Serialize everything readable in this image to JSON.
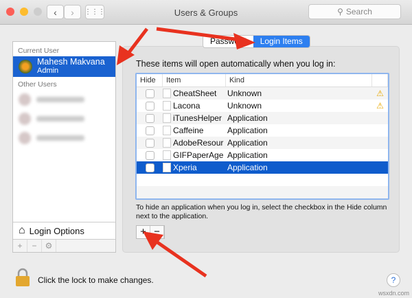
{
  "window": {
    "title": "Users & Groups",
    "search_placeholder": "Search"
  },
  "sidebar": {
    "current_user_header": "Current User",
    "current_user": {
      "name": "Mahesh Makvana",
      "role": "Admin"
    },
    "other_users_header": "Other Users",
    "login_options": "Login Options",
    "add": "+",
    "remove": "−",
    "gear": "⚙"
  },
  "tabs": [
    {
      "label": "Password"
    },
    {
      "label": "Login Items"
    }
  ],
  "login_items": {
    "intro": "These items will open automatically when you log in:",
    "columns": [
      "Hide",
      "Item",
      "Kind"
    ],
    "rows": [
      {
        "item": "CheatSheet",
        "kind": "Unknown",
        "warn": "⚠"
      },
      {
        "item": "Lacona",
        "kind": "Unknown",
        "warn": "⚠"
      },
      {
        "item": "iTunesHelper",
        "kind": "Application",
        "warn": ""
      },
      {
        "item": "Caffeine",
        "kind": "Application",
        "warn": ""
      },
      {
        "item": "AdobeResour",
        "kind": "Application",
        "warn": ""
      },
      {
        "item": "GIFPaperAge",
        "kind": "Application",
        "warn": ""
      },
      {
        "item": "Xperia",
        "kind": "Application",
        "warn": ""
      }
    ],
    "note": "To hide an application when you log in, select the checkbox in the Hide column next to the application.",
    "add": "+",
    "remove": "−"
  },
  "footer": {
    "lock_text": "Click the lock to make changes.",
    "help": "?"
  },
  "watermark": "wsxdn.com"
}
